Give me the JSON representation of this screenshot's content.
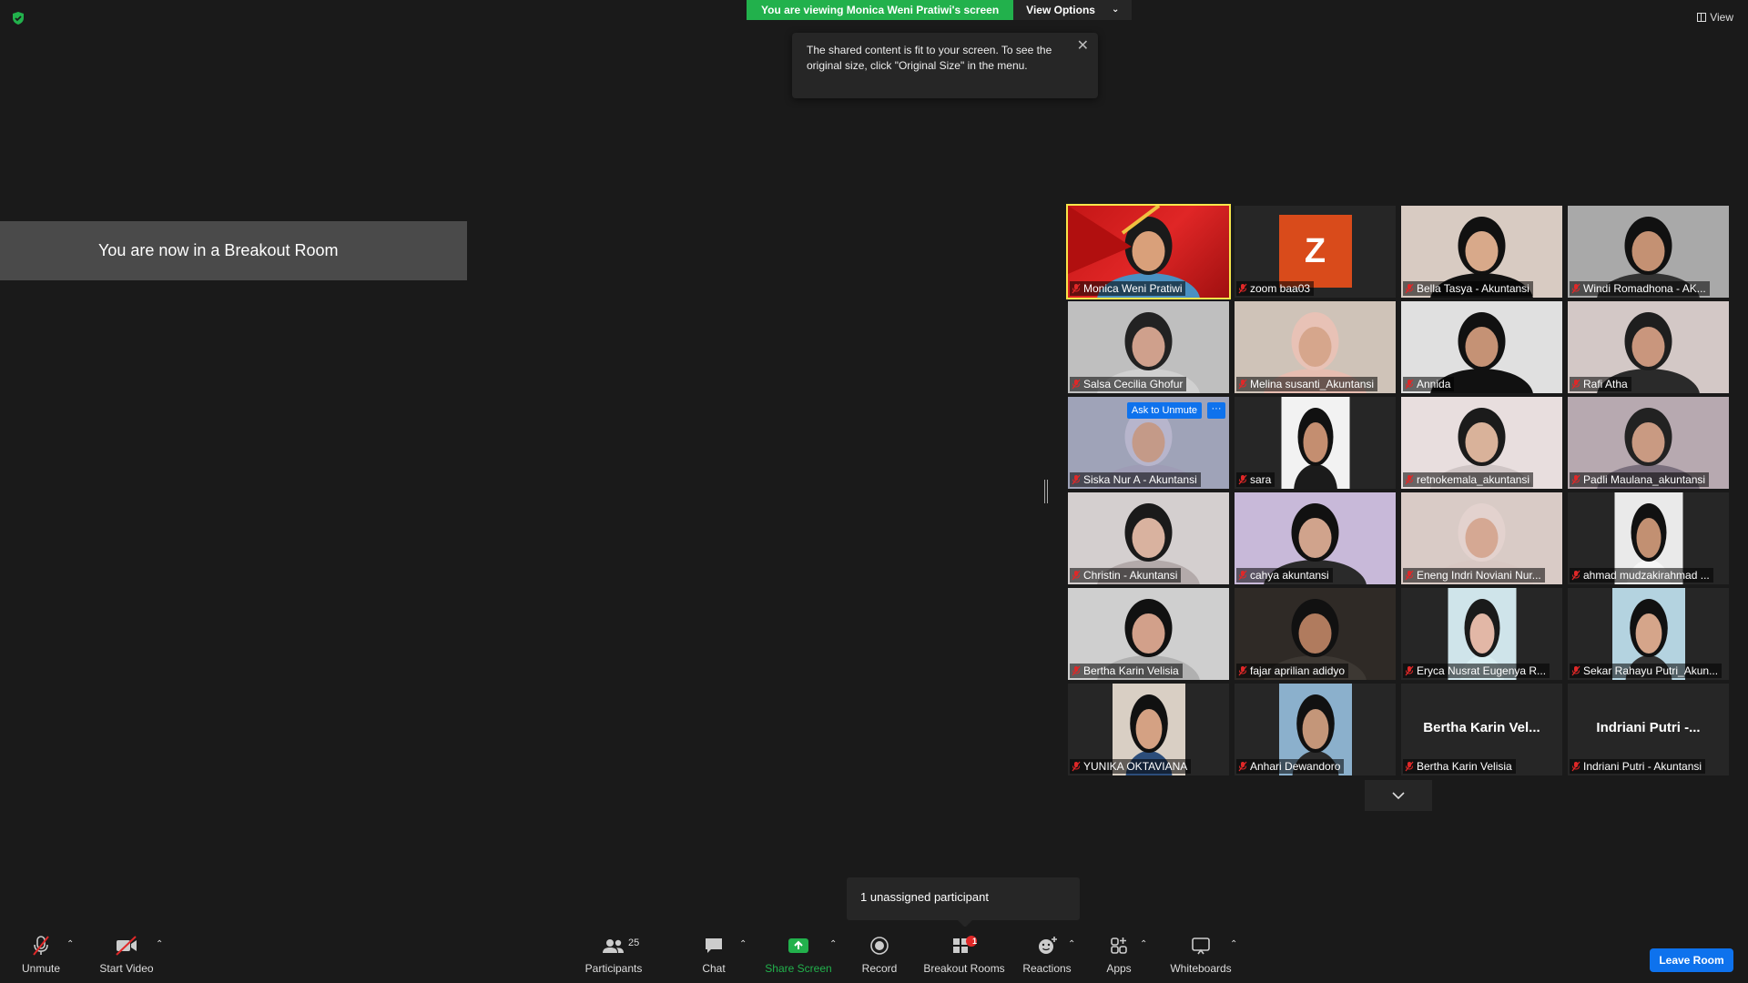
{
  "share_banner": "You are viewing Monica Weni Pratiwi's screen",
  "view_options": "View Options",
  "view_top": "View",
  "tooltip_text": "The shared content is fit to your screen. To see the original size, click \"Original Size\" in the menu.",
  "breakout_text": "You are now in a Breakout Room",
  "tiles": [
    {
      "label": "Monica Weni Pratiwi",
      "active": true
    },
    {
      "label": "zoom baa03",
      "initial": "Z"
    },
    {
      "label": "Bella Tasya - Akuntansi"
    },
    {
      "label": "Windi Romadhona - AK..."
    },
    {
      "label": "Salsa Cecilia Ghofur"
    },
    {
      "label": "Melina susanti_Akuntansi"
    },
    {
      "label": "Annida"
    },
    {
      "label": "Rafi Atha"
    },
    {
      "label": "Siska Nur A - Akuntansi",
      "ask_unmute": "Ask to Unmute",
      "more": "···"
    },
    {
      "label": "sara"
    },
    {
      "label": "retnokemala_akuntansi"
    },
    {
      "label": "Padli Maulana_akuntansi"
    },
    {
      "label": "Christin - Akuntansi"
    },
    {
      "label": "cahya akuntansi"
    },
    {
      "label": "Eneng Indri Noviani Nur..."
    },
    {
      "label": "ahmad mudzakirahmad ..."
    },
    {
      "label": "Bertha Karin Velisia"
    },
    {
      "label": "fajar aprilian adidyo"
    },
    {
      "label": "Eryca Nusrat Eugenya R..."
    },
    {
      "label": "Sekar Rahayu Putri_Akun..."
    },
    {
      "label": "YUNIKA OKTAVIANA"
    },
    {
      "label": "Anhari Dewandoro"
    },
    {
      "label": "Bertha Karin Velisia",
      "bigname": "Bertha Karin Vel..."
    },
    {
      "label": "Indriani Putri - Akuntansi",
      "bigname": "Indriani Putri -..."
    }
  ],
  "unassigned": "1 unassigned participant",
  "toolbar": {
    "unmute": "Unmute",
    "start_video": "Start Video",
    "participants": "Participants",
    "participants_count": "25",
    "chat": "Chat",
    "share_screen": "Share Screen",
    "record": "Record",
    "breakout_rooms": "Breakout Rooms",
    "breakout_badge": "1",
    "reactions": "Reactions",
    "apps": "Apps",
    "whiteboards": "Whiteboards",
    "leave_room": "Leave Room"
  },
  "colors": {
    "accent_green": "#22b14c",
    "accent_blue": "#0e72ed",
    "active_speaker": "#f7e64b",
    "mute_red": "#e02828",
    "background": "#1a1a1a"
  }
}
